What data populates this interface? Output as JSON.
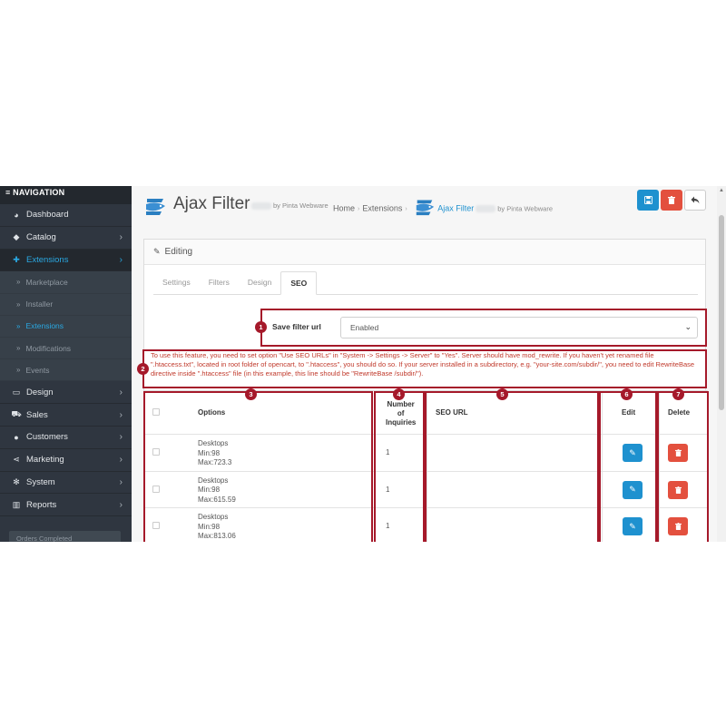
{
  "sidebar": {
    "header": "≡ NAVIGATION",
    "items": [
      {
        "label": "Dashboard",
        "icon": "dashboard-icon",
        "glyph": "◕"
      },
      {
        "label": "Catalog",
        "icon": "tag-icon",
        "glyph": "◆",
        "chevron": "›"
      },
      {
        "label": "Extensions",
        "icon": "puzzle-icon",
        "glyph": "✚",
        "chevron": "›",
        "active": true
      },
      {
        "label": "Design",
        "icon": "monitor-icon",
        "glyph": "▭",
        "chevron": "›"
      },
      {
        "label": "Sales",
        "icon": "cart-icon",
        "glyph": "⛟",
        "chevron": "›"
      },
      {
        "label": "Customers",
        "icon": "user-icon",
        "glyph": "●",
        "chevron": "›"
      },
      {
        "label": "Marketing",
        "icon": "share-icon",
        "glyph": "⋖",
        "chevron": "›"
      },
      {
        "label": "System",
        "icon": "cog-icon",
        "glyph": "✻",
        "chevron": "›"
      },
      {
        "label": "Reports",
        "icon": "bar-chart-icon",
        "glyph": "▥",
        "chevron": "›"
      }
    ],
    "subitems": [
      {
        "label": "Marketplace"
      },
      {
        "label": "Installer"
      },
      {
        "label": "Extensions",
        "active": true
      },
      {
        "label": "Modifications"
      },
      {
        "label": "Events"
      }
    ],
    "progress_label": "Orders Completed"
  },
  "header": {
    "title": "Ajax Filter",
    "vendor": "by Pinta Webware",
    "breadcrumb": {
      "home": "Home",
      "extensions": "Extensions",
      "current": "Ajax Filter",
      "vendor": "by Pinta Webware"
    },
    "save_icon": "save-icon",
    "delete_icon": "trash-icon",
    "back_icon": "reply-icon"
  },
  "panel": {
    "title": "Editing",
    "tabs": [
      "Settings",
      "Filters",
      "Design",
      "SEO"
    ],
    "active_tab": "SEO"
  },
  "form": {
    "label": "Save filter url",
    "selected": "Enabled"
  },
  "notice": "To use this feature, you need to set option \"Use SEO URLs\" in \"System -> Settings -> Server\" to \"Yes\". Server should have mod_rewrite. If you haven't yet renamed file \".htaccess.txt\", located in root folder of opencart, to \".htaccess\", you should do so. If your server installed in a subdirectory, e.g. \"your-site.com/subdir/\", you need to edit RewriteBase directive inside \".htaccess\" file (in this example, this line should be \"RewriteBase /subdir/\").",
  "table": {
    "columns": [
      "Options",
      "Number of Inquiries",
      "SEO URL",
      "Edit",
      "Delete"
    ],
    "col_number_lines": [
      "Number",
      "of",
      "Inquiries"
    ],
    "rows": [
      {
        "options": [
          "Desktops",
          "Min:98",
          "Max:723.3"
        ],
        "inquiries": "1",
        "seo_url": ""
      },
      {
        "options": [
          "Desktops",
          "Min:98",
          "Max:615.59"
        ],
        "inquiries": "1",
        "seo_url": ""
      },
      {
        "options": [
          "Desktops",
          "Min:98",
          "Max:813.06"
        ],
        "inquiries": "1",
        "seo_url": ""
      }
    ]
  },
  "annotations": [
    "1",
    "2",
    "3",
    "4",
    "5",
    "6",
    "7"
  ],
  "colors": {
    "annotation": "#a5192a",
    "primary": "#1e91cf",
    "danger": "#e3503e",
    "sidebar": "#2f3640",
    "notice_text": "#c0392b"
  }
}
